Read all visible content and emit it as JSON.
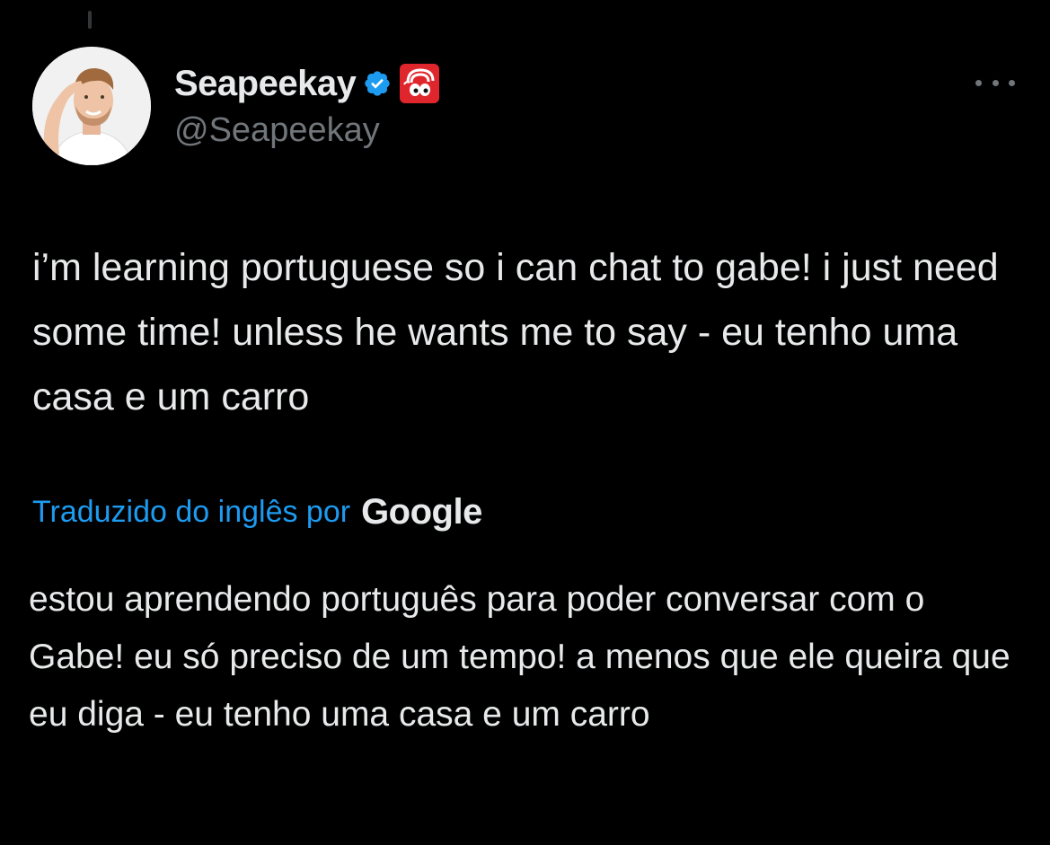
{
  "tweet": {
    "author": {
      "display_name": "Seapeekay",
      "handle": "@Seapeekay",
      "verified": true,
      "verified_color": "#1d9bf0",
      "affiliate_badge": "red-mascot-badge",
      "affiliate_badge_color": "#e0262d"
    },
    "text": "i’m learning portuguese so i can chat to gabe! i just need some time! unless he wants me to say - eu tenho uma casa e um carro",
    "translation": {
      "label": "Traduzido do inglês por",
      "provider": "Google",
      "text": "estou aprendendo português para poder conversar com o Gabe! eu só preciso de um tempo! a menos que ele queira que eu diga - eu tenho uma casa e um carro"
    }
  },
  "icons": {
    "more": "more-horizontal-icon",
    "verified": "verified-badge-icon"
  },
  "colors": {
    "background": "#000000",
    "text_primary": "#e7e9ea",
    "text_secondary": "#71767b",
    "link": "#1d9bf0"
  }
}
